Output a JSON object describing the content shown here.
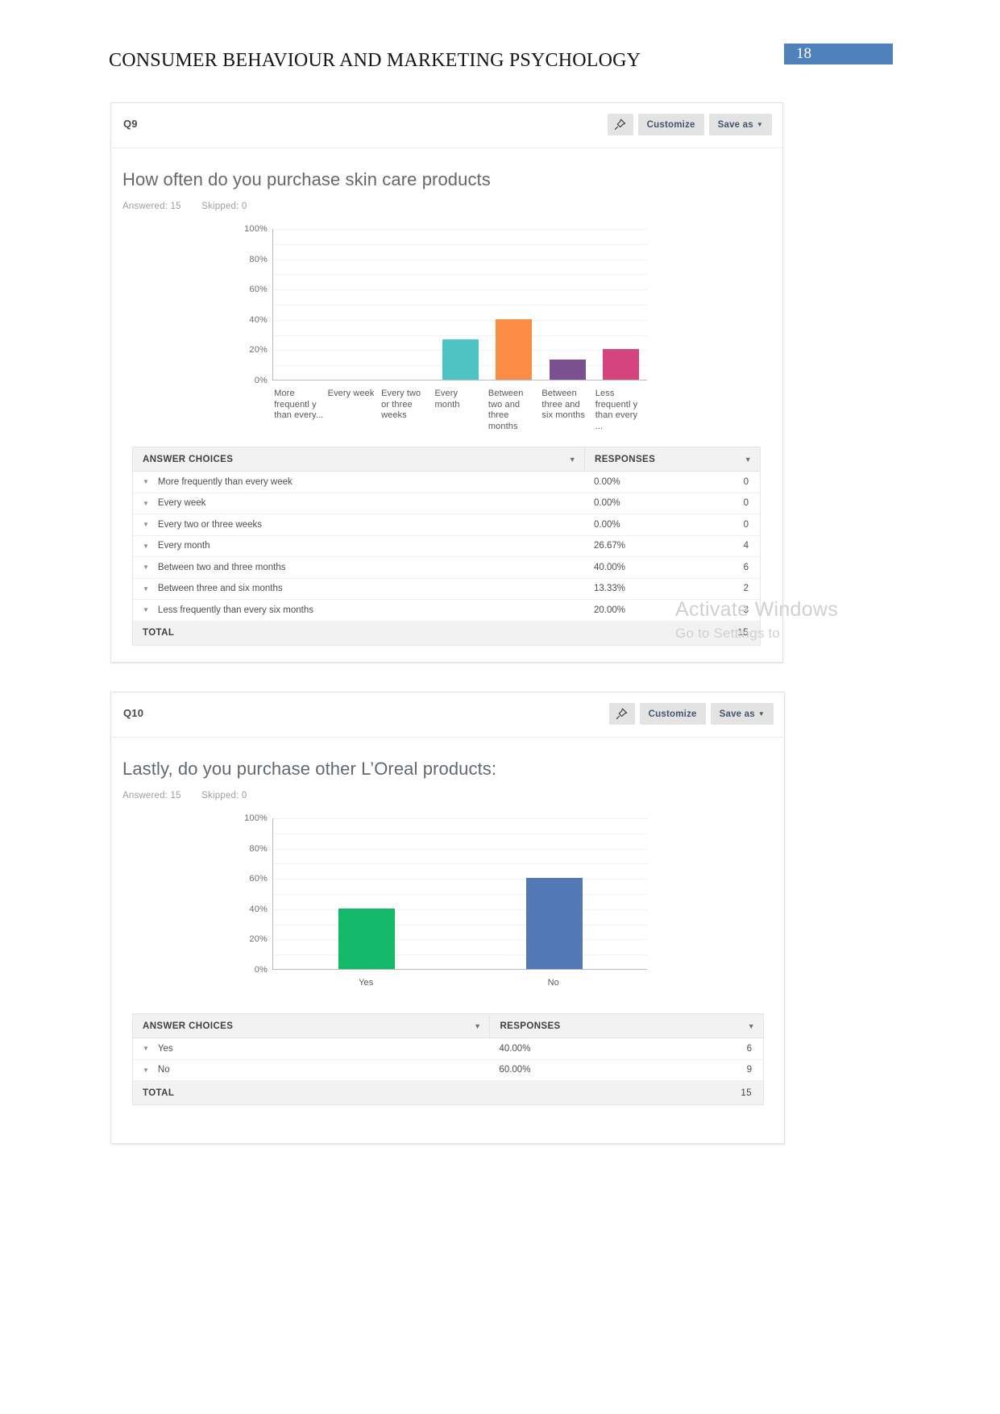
{
  "document": {
    "header_title": "CONSUMER BEHAVIOUR AND MARKETING PSYCHOLOGY",
    "page_number": "18",
    "accent_color": "#4f81bd"
  },
  "watermark": {
    "line1": "Activate Windows",
    "line2": "Go to Settings to"
  },
  "panels": [
    {
      "question_label": "Q9",
      "title": "How often do you purchase skin care products",
      "answered_label": "Answered: 15",
      "skipped_label": "Skipped: 0",
      "toolbar": {
        "pin_icon": "pin-icon",
        "customize_label": "Customize",
        "save_as_label": "Save as",
        "caret": "▼"
      },
      "table": {
        "col_choices": "ANSWER CHOICES",
        "col_responses": "RESPONSES",
        "total_label": "TOTAL",
        "total_count": "15",
        "rows": [
          {
            "choice": "More frequently than every week",
            "percent": "0.00%",
            "count": "0"
          },
          {
            "choice": "Every week",
            "percent": "0.00%",
            "count": "0"
          },
          {
            "choice": "Every two or three weeks",
            "percent": "0.00%",
            "count": "0"
          },
          {
            "choice": "Every month",
            "percent": "26.67%",
            "count": "4"
          },
          {
            "choice": "Between two and three months",
            "percent": "40.00%",
            "count": "6"
          },
          {
            "choice": "Between three and six months",
            "percent": "13.33%",
            "count": "2"
          },
          {
            "choice": "Less frequently than every six months",
            "percent": "20.00%",
            "count": "3"
          }
        ]
      },
      "chart_data": {
        "type": "bar",
        "title": "How often do you purchase skin care products",
        "xlabel": "",
        "ylabel": "",
        "ylim": [
          0,
          100
        ],
        "yticks": [
          "0%",
          "20%",
          "40%",
          "60%",
          "80%",
          "100%"
        ],
        "grid": true,
        "legend": "none",
        "categories": [
          "More frequentl y than every...",
          "Every week",
          "Every two or three weeks",
          "Every month",
          "Between two and three months",
          "Between three and six months",
          "Less frequentl y than every ..."
        ],
        "values": [
          0,
          0,
          0,
          26.67,
          40.0,
          13.33,
          20.0
        ],
        "colors": [
          "#4bb8bd",
          "#4bb8bd",
          "#4bb8bd",
          "#4ec3c3",
          "#fb8c45",
          "#7b5091",
          "#d6447f"
        ]
      }
    },
    {
      "question_label": "Q10",
      "title": "Lastly, do you purchase other L’Oreal products:",
      "answered_label": "Answered: 15",
      "skipped_label": "Skipped: 0",
      "toolbar": {
        "pin_icon": "pin-icon",
        "customize_label": "Customize",
        "save_as_label": "Save as",
        "caret": "▼"
      },
      "table": {
        "col_choices": "ANSWER CHOICES",
        "col_responses": "RESPONSES",
        "total_label": "TOTAL",
        "total_count": "15",
        "rows": [
          {
            "choice": "Yes",
            "percent": "40.00%",
            "count": "6"
          },
          {
            "choice": "No",
            "percent": "60.00%",
            "count": "9"
          }
        ]
      },
      "chart_data": {
        "type": "bar",
        "title": "Lastly, do you purchase other L’Oreal products:",
        "xlabel": "",
        "ylabel": "",
        "ylim": [
          0,
          100
        ],
        "yticks": [
          "0%",
          "20%",
          "40%",
          "60%",
          "80%",
          "100%"
        ],
        "grid": true,
        "legend": "none",
        "categories": [
          "Yes",
          "No"
        ],
        "values": [
          40.0,
          60.0
        ],
        "colors": [
          "#13b869",
          "#5378b8"
        ]
      }
    }
  ]
}
